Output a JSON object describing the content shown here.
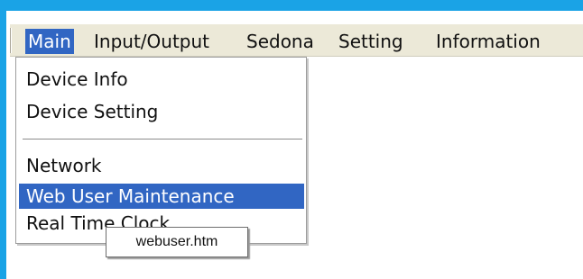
{
  "menubar": {
    "items": [
      {
        "label": "Main",
        "active": true
      },
      {
        "label": "Input/Output"
      },
      {
        "label": "Sedona"
      },
      {
        "label": "Setting"
      },
      {
        "label": "Information"
      }
    ]
  },
  "dropdown": {
    "items": [
      {
        "label": "Device Info"
      },
      {
        "label": "Device Setting"
      },
      {
        "label": "Network"
      },
      {
        "label": "Web User Maintenance",
        "highlighted": true
      },
      {
        "label": "Real Time Clock"
      }
    ]
  },
  "tooltip": {
    "text": "webuser.htm"
  },
  "colors": {
    "frame": "#1aa3e6",
    "menubar_bg": "#ece9d8",
    "highlight": "#3166c3"
  }
}
